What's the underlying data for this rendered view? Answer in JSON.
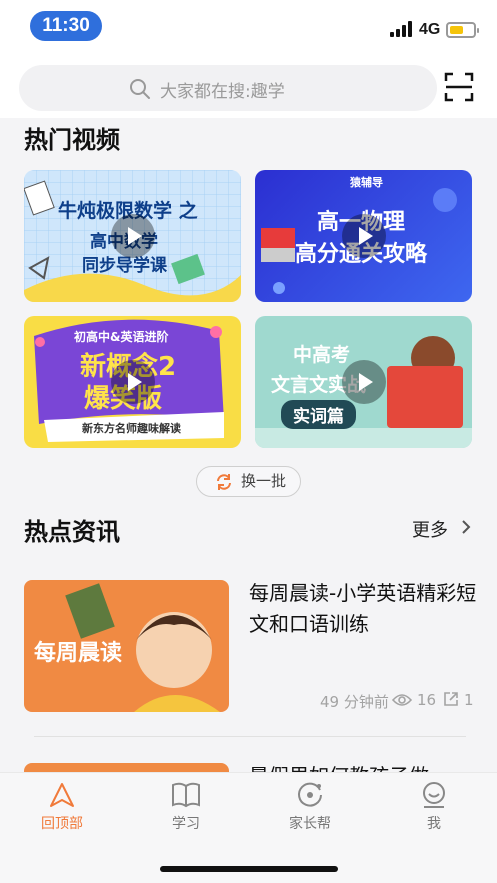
{
  "status_bar": {
    "time": "11:30",
    "network": "4G",
    "battery_level": 0.55
  },
  "search": {
    "placeholder": "大家都在搜:趣学"
  },
  "hot_videos": {
    "title": "热门视频",
    "cards": [
      {
        "line1": "牛炖极限数学 之",
        "line2": "高中数学",
        "line3": "同步导学课"
      },
      {
        "brand": "猿辅导",
        "line1": "高一物理",
        "line2": "高分通关攻略"
      },
      {
        "tag": "初高中&英语进阶",
        "line1": "新概念2",
        "line2": "爆笑版",
        "footer": "新东方名师趣味解读"
      },
      {
        "line1": "中高考",
        "line2": "文言文实战",
        "line3": "实词篇"
      }
    ],
    "refresh_label": "换一批"
  },
  "hot_news": {
    "title": "热点资讯",
    "more_label": "更多",
    "items": [
      {
        "thumb_text": "每周晨读",
        "title": "每周晨读-小学英语精彩短文和口语训练",
        "time": "49 分钟前",
        "views": "16",
        "shares": "1"
      },
      {
        "title": "暑假里如何教孩子做"
      }
    ]
  },
  "tabbar": {
    "tabs": [
      {
        "label": "回顶部",
        "active": true
      },
      {
        "label": "学习",
        "active": false
      },
      {
        "label": "家长帮",
        "active": false
      },
      {
        "label": "我",
        "active": false
      }
    ]
  },
  "colors": {
    "accent": "#f07a3a",
    "time_pill": "#2f6fdc"
  }
}
